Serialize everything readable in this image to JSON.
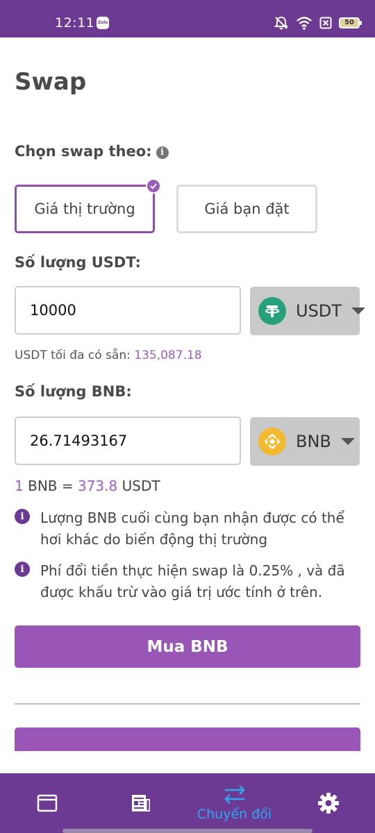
{
  "status_bar": {
    "time": "12:11",
    "notification_app": "Zalo",
    "battery_level": "50",
    "icons": [
      "zalo-icon",
      "mute-alarm-icon",
      "wifi-icon",
      "sim-off-icon",
      "battery-icon"
    ]
  },
  "page": {
    "title": "Swap"
  },
  "swap_mode": {
    "label": "Chọn swap theo:",
    "options": [
      "Giá thị trường",
      "Giá bạn đặt"
    ],
    "selected_index": 0
  },
  "from": {
    "label": "Số lượng USDT:",
    "value": "10000",
    "token": "USDT",
    "available_label": "USDT tối đa có sẵn:",
    "available_value": "135,087.18"
  },
  "to": {
    "label": "Số lượng BNB:",
    "value": "26.71493167",
    "token": "BNB"
  },
  "rate": {
    "base_amount": "1",
    "base_token": "BNB",
    "equals": "=",
    "quote_amount": "373.8",
    "quote_token": "USDT"
  },
  "notes": [
    "Lượng BNB cuối cùng bạn nhận được có thể hơi khác do biến động thị trường",
    "Phí đổi tiền thực hiện swap là 0.25% , và đã được khấu trừ vào giá trị ước tính ở trên."
  ],
  "actions": {
    "buy_label": "Mua BNB"
  },
  "bottom_nav": {
    "items": [
      {
        "icon": "window-icon",
        "label": ""
      },
      {
        "icon": "news-icon",
        "label": ""
      },
      {
        "icon": "swap-arrows-icon",
        "label": "Chuyển đổi"
      },
      {
        "icon": "gear-icon",
        "label": ""
      }
    ],
    "active_index": 2,
    "active_color": "#2ea6f2"
  },
  "colors": {
    "brand": "#6d3a93",
    "button": "#9a56b6",
    "accent": "#a05cc4",
    "usdt": "#26a17b",
    "bnb": "#f3ba2f"
  }
}
